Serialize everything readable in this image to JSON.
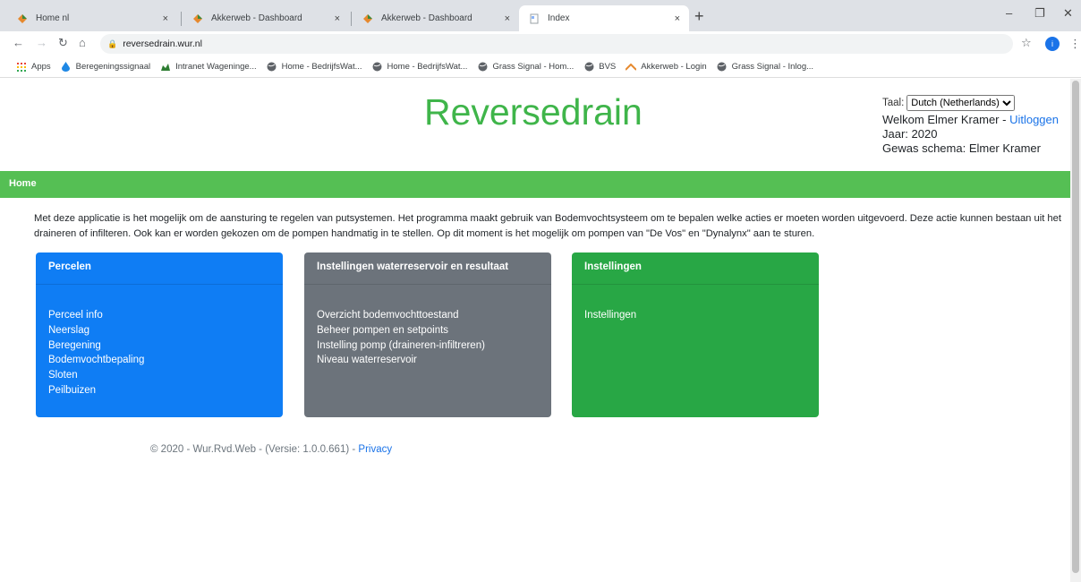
{
  "browser": {
    "tabs": [
      {
        "title": "Home nl",
        "active": false
      },
      {
        "title": "Akkerweb - Dashboard",
        "active": false
      },
      {
        "title": "Akkerweb - Dashboard",
        "active": false
      },
      {
        "title": "Index",
        "active": true
      }
    ],
    "tab_close": "×",
    "new_tab": "+",
    "url": "reversedrain.wur.nl",
    "profile_initial": "i",
    "bookmarks": [
      {
        "label": "Apps",
        "icon": "apps-grid-icon"
      },
      {
        "label": "Beregeningssignaal",
        "icon": "water-drop-icon"
      },
      {
        "label": "Intranet Wageninge...",
        "icon": "intranet-icon"
      },
      {
        "label": "Home - BedrijfsWat...",
        "icon": "globe-icon"
      },
      {
        "label": "Home - BedrijfsWat...",
        "icon": "globe-icon"
      },
      {
        "label": "Grass Signal - Hom...",
        "icon": "globe-icon"
      },
      {
        "label": "BVS",
        "icon": "globe-icon"
      },
      {
        "label": "Akkerweb - Login",
        "icon": "akkerweb-icon"
      },
      {
        "label": "Grass Signal - Inlog...",
        "icon": "globe-icon"
      }
    ]
  },
  "header": {
    "brand": "Reversedrain",
    "language_label": "Taal:",
    "language_selected": "Dutch (Netherlands)",
    "welcome_prefix": "Welkom Elmer Kramer - ",
    "logout": "Uitloggen",
    "year": "Jaar: 2020",
    "crop_schema": "Gewas schema: Elmer Kramer"
  },
  "nav": {
    "home": "Home"
  },
  "intro": "Met deze applicatie is het mogelijk om de aansturing te regelen van putsystemen. Het programma maakt gebruik van Bodemvochtsysteem om te bepalen welke acties er moeten worden uitgevoerd. Deze actie kunnen bestaan uit het draineren of infilteren. Ook kan er worden gekozen om de pompen handmatig in te stellen. Op dit moment is het mogelijk om pompen van \"De Vos\" en \"Dynalynx\" aan te sturen.",
  "cards": [
    {
      "title": "Percelen",
      "color": "#0f7df4",
      "links": [
        "Perceel info",
        "Neerslag",
        "Beregening",
        "Bodemvochtbepaling",
        "Sloten",
        "Peilbuizen"
      ]
    },
    {
      "title": "Instellingen waterreservoir en resultaat",
      "color": "#6c737b",
      "links": [
        "Overzicht bodemvochttoestand",
        "Beheer pompen en setpoints",
        "Instelling pomp (draineren-infiltreren)",
        "Niveau waterreservoir"
      ]
    },
    {
      "title": "Instellingen",
      "color": "#28a745",
      "links": [
        "Instellingen"
      ]
    }
  ],
  "footer": {
    "text": "© 2020 - Wur.Rvd.Web - (Versie: 1.0.0.661) - ",
    "privacy": "Privacy"
  },
  "colors": {
    "brand": "#3fb54a",
    "navbar": "#55bf54",
    "link": "#1a73e8"
  }
}
